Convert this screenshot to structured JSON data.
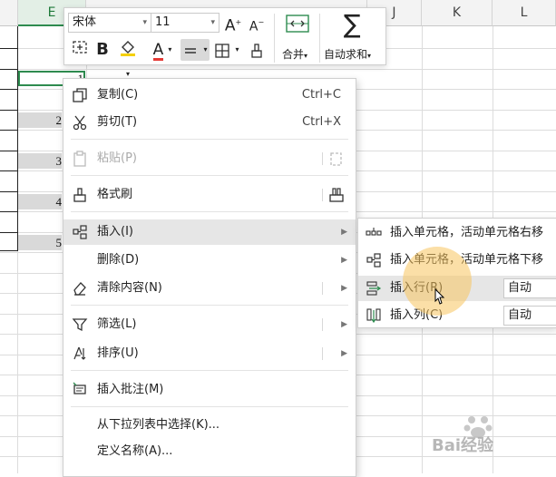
{
  "sheet": {
    "columns": [
      {
        "label": "E",
        "selected": true
      },
      {
        "label": "",
        "selected": false
      },
      {
        "label": "",
        "selected": false
      },
      {
        "label": "",
        "selected": false
      },
      {
        "label": "",
        "selected": false
      },
      {
        "label": "J",
        "selected": false
      },
      {
        "label": "K",
        "selected": false
      },
      {
        "label": "L",
        "selected": false
      }
    ],
    "cells": [
      "1",
      "2",
      "3",
      "4",
      "5"
    ]
  },
  "toolbar": {
    "font_name": "宋体",
    "font_size": "11",
    "merge_label": "合并",
    "autosum_label": "自动求和",
    "bold_label": "B",
    "font_color_label": "A",
    "grow_font_label": "A",
    "shrink_font_label": "A",
    "colors": {
      "fill": "#f5d000",
      "font": "#e53935"
    },
    "icons": [
      "format-painter-icon",
      "fill-color-icon",
      "font-color-icon",
      "align-icon",
      "border-icon",
      "brush-icon",
      "merge-icon",
      "sum-icon"
    ]
  },
  "menu": {
    "copy": {
      "label": "复制(C)",
      "shortcut": "Ctrl+C"
    },
    "cut": {
      "label": "剪切(T)",
      "shortcut": "Ctrl+X"
    },
    "paste": {
      "label": "粘贴(P)"
    },
    "format_painter": {
      "label": "格式刷"
    },
    "insert": {
      "label": "插入(I)"
    },
    "delete": {
      "label": "删除(D)"
    },
    "clear": {
      "label": "清除内容(N)"
    },
    "filter": {
      "label": "筛选(L)"
    },
    "sort": {
      "label": "排序(U)"
    },
    "insert_comment": {
      "label": "插入批注(M)"
    },
    "pick_from_list": {
      "label": "从下拉列表中选择(K)..."
    },
    "define_name": {
      "label": "定义名称(A)..."
    }
  },
  "submenu": {
    "insert_cells_right": {
      "label": "插入单元格，活动单元格右移"
    },
    "insert_cells_down": {
      "label": "插入单元格，活动单元格下移"
    },
    "insert_row": {
      "label": "插入行(R)",
      "value": "自动"
    },
    "insert_column": {
      "label": "插入列(C)",
      "value": "自动"
    }
  },
  "watermark": {
    "text": "Bai经验"
  }
}
